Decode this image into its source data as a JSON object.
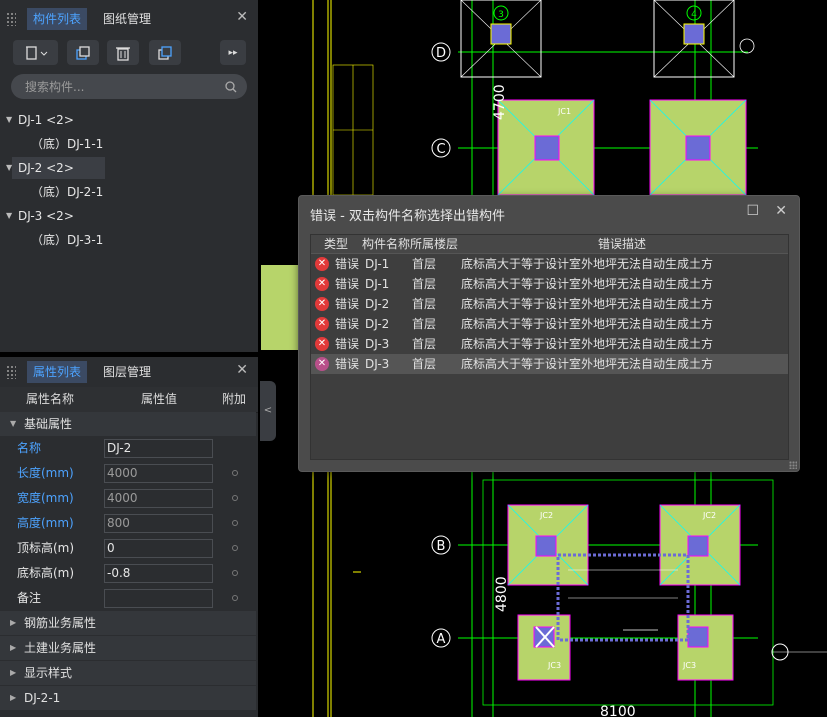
{
  "component_panel": {
    "tabs": [
      "构件列表",
      "图纸管理"
    ],
    "close": "✕",
    "search_placeholder": "搜索构件...",
    "tree": [
      {
        "label": "DJ-1  <2>",
        "level": 0
      },
      {
        "label": "（底）DJ-1-1",
        "level": 1
      },
      {
        "label": "DJ-2  <2>",
        "level": 0,
        "selected": true
      },
      {
        "label": "（底）DJ-2-1",
        "level": 1
      },
      {
        "label": "DJ-3  <2>",
        "level": 0
      },
      {
        "label": "（底）DJ-3-1",
        "level": 1
      }
    ]
  },
  "property_panel": {
    "tabs": [
      "属性列表",
      "图层管理"
    ],
    "close": "✕",
    "columns": [
      "属性名称",
      "属性值",
      "附加"
    ],
    "basic_section": "基础属性",
    "rows": [
      {
        "name": "名称",
        "value": "DJ-2",
        "name_color": "blue"
      },
      {
        "name": "长度(mm)",
        "value": "4000",
        "name_color": "blue"
      },
      {
        "name": "宽度(mm)",
        "value": "4000",
        "name_color": "blue"
      },
      {
        "name": "高度(mm)",
        "value": "800",
        "name_color": "blue"
      },
      {
        "name": "顶标高(m)",
        "value": "0",
        "name_color": "white"
      },
      {
        "name": "底标高(m)",
        "value": "-0.8",
        "name_color": "white"
      },
      {
        "name": "备注",
        "value": "",
        "name_color": "white"
      }
    ],
    "sections": [
      "钢筋业务属性",
      "土建业务属性",
      "显示样式",
      "DJ-2-1"
    ]
  },
  "error_dialog": {
    "title": "错误 - 双击构件名称选择出错构件",
    "columns": [
      "类型",
      "构件名称",
      "所属楼层",
      "错误描述"
    ],
    "rows": [
      {
        "type": "错误",
        "name": "DJ-1",
        "floor": "首层",
        "desc": "底标高大于等于设计室外地坪无法自动生成土方"
      },
      {
        "type": "错误",
        "name": "DJ-1",
        "floor": "首层",
        "desc": "底标高大于等于设计室外地坪无法自动生成土方"
      },
      {
        "type": "错误",
        "name": "DJ-2",
        "floor": "首层",
        "desc": "底标高大于等于设计室外地坪无法自动生成土方"
      },
      {
        "type": "错误",
        "name": "DJ-2",
        "floor": "首层",
        "desc": "底标高大于等于设计室外地坪无法自动生成土方"
      },
      {
        "type": "错误",
        "name": "DJ-3",
        "floor": "首层",
        "desc": "底标高大于等于设计室外地坪无法自动生成土方"
      },
      {
        "type": "错误",
        "name": "DJ-3",
        "floor": "首层",
        "desc": "底标高大于等于设计室外地坪无法自动生成土方"
      }
    ]
  },
  "drawing": {
    "axes": [
      "D",
      "C",
      "B",
      "A"
    ],
    "column_marks": [
      "3",
      "4"
    ],
    "dims": [
      "4700",
      "4800",
      "8100"
    ],
    "pad_label": "JC1",
    "pad_label_2": "JC2",
    "pad_label_3": "JC3",
    "colors": {
      "pad": "#b7d46a",
      "line_green": "#00ff00",
      "line_yellow": "#ffff00",
      "magenta": "#ff00ff",
      "cyan": "#00ffff"
    }
  }
}
